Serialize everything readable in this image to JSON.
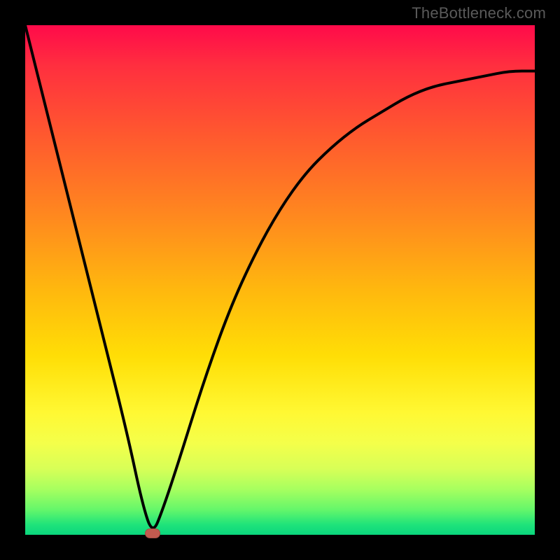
{
  "watermark": "TheBottleneck.com",
  "colors": {
    "frame": "#000000",
    "curve": "#000000",
    "min_marker": "#c25a4f",
    "gradient_top": "#ff0a4a",
    "gradient_bottom": "#0ad67d"
  },
  "chart_data": {
    "type": "line",
    "title": "",
    "xlabel": "",
    "ylabel": "",
    "xlim": [
      0,
      100
    ],
    "ylim": [
      0,
      100
    ],
    "note": "x and y are in percent of the plot area width/height; y=0 is the bottom (green), y=100 is the top (red). V-shaped bottleneck curve with minimum near x≈25.",
    "min_point": {
      "x": 25,
      "y": 0
    },
    "series": [
      {
        "name": "bottleneck-curve",
        "x": [
          0,
          5,
          10,
          15,
          20,
          23,
          25,
          27,
          30,
          35,
          40,
          45,
          50,
          55,
          60,
          65,
          70,
          75,
          80,
          85,
          90,
          95,
          100
        ],
        "y": [
          100,
          80,
          60,
          40,
          20,
          6,
          0,
          5,
          14,
          30,
          44,
          55,
          64,
          71,
          76,
          80,
          83,
          86,
          88,
          89,
          90,
          91,
          91
        ]
      }
    ]
  }
}
